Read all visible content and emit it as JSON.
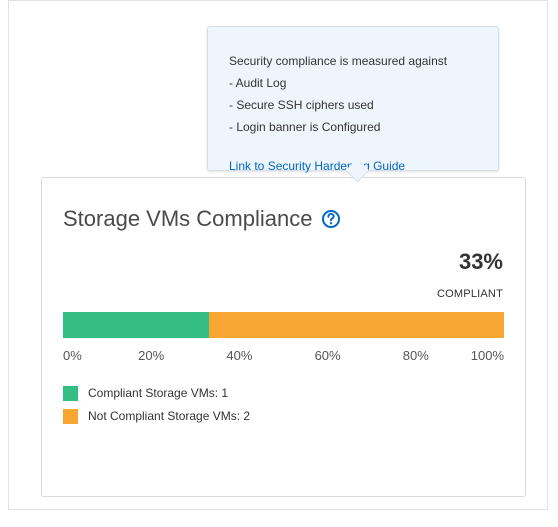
{
  "card": {
    "title": "Storage VMs Compliance",
    "help_icon": "question-circle-icon",
    "percent": "33%",
    "percent_label": "COMPLIANT"
  },
  "bar": {
    "compliant_fraction": 0.33,
    "compliant_color": "#35be84",
    "noncompliant_color": "#f7a632",
    "ticks": [
      "0%",
      "20%",
      "40%",
      "60%",
      "80%",
      "100%"
    ]
  },
  "legend": [
    {
      "label": "Compliant Storage VMs: 1",
      "color": "#35be84"
    },
    {
      "label": "Not Compliant Storage VMs: 2",
      "color": "#f7a632"
    }
  ],
  "tooltip": {
    "lines": [
      "Security compliance is measured against",
      "- Audit Log",
      "- Secure SSH ciphers used",
      "- Login banner is Configured"
    ],
    "link": "Link to Security Hardening Guide"
  }
}
